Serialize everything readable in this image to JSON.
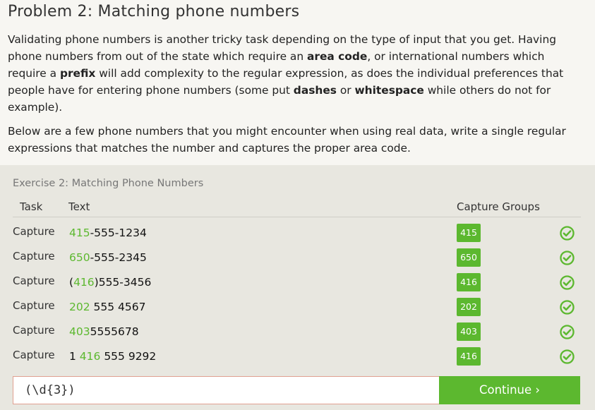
{
  "lesson": {
    "title": "Problem 2: Matching phone numbers",
    "p1": [
      {
        "t": "Validating phone numbers is another tricky task depending on the type of input that you get. Having phone numbers from out of the state which require an ",
        "b": false
      },
      {
        "t": "area code",
        "b": true
      },
      {
        "t": ", or international numbers which require a ",
        "b": false
      },
      {
        "t": "prefix",
        "b": true
      },
      {
        "t": " will add complexity to the regular expression, as does the individual preferences that people have for entering phone numbers (some put ",
        "b": false
      },
      {
        "t": "dashes",
        "b": true
      },
      {
        "t": " or ",
        "b": false
      },
      {
        "t": "whitespace",
        "b": true
      },
      {
        "t": " while others do not for example).",
        "b": false
      }
    ],
    "p2": "Below are a few phone numbers that you might encounter when using real data, write a single regular expressions that matches the number and captures the proper area code."
  },
  "exercise": {
    "title": "Exercise 2: Matching Phone Numbers",
    "headers": {
      "task": "Task",
      "text": "Text",
      "capture": "Capture Groups"
    },
    "rows": [
      {
        "task": "Capture",
        "pre": "",
        "match": "415",
        "post": "-555-1234",
        "group": "415",
        "status": "check-circle-icon"
      },
      {
        "task": "Capture",
        "pre": "",
        "match": "650",
        "post": "-555-2345",
        "group": "650",
        "status": "check-circle-icon"
      },
      {
        "task": "Capture",
        "pre": "(",
        "match": "416",
        "post": ")555-3456",
        "group": "416",
        "status": "check-circle-icon"
      },
      {
        "task": "Capture",
        "pre": "",
        "match": "202",
        "post": " 555 4567",
        "group": "202",
        "status": "check-circle-icon"
      },
      {
        "task": "Capture",
        "pre": "",
        "match": "403",
        "post": "5555678",
        "group": "403",
        "status": "check-circle-icon"
      },
      {
        "task": "Capture",
        "pre": "1 ",
        "match": "416",
        "post": " 555 9292",
        "group": "416",
        "status": "check-circle-icon"
      }
    ],
    "input_value": "(\\d{3})",
    "continue_label": "Continue ›"
  },
  "colors": {
    "accent": "#5cb82f",
    "panel": "#e8e7e0",
    "background": "#f7f6f2"
  }
}
